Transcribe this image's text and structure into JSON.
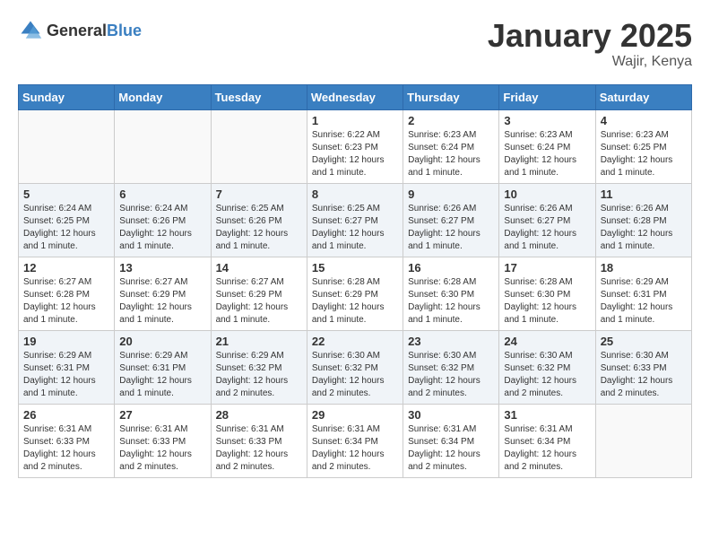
{
  "header": {
    "logo_general": "General",
    "logo_blue": "Blue",
    "month_title": "January 2025",
    "location": "Wajir, Kenya"
  },
  "weekdays": [
    "Sunday",
    "Monday",
    "Tuesday",
    "Wednesday",
    "Thursday",
    "Friday",
    "Saturday"
  ],
  "weeks": [
    [
      {
        "day": "",
        "info": ""
      },
      {
        "day": "",
        "info": ""
      },
      {
        "day": "",
        "info": ""
      },
      {
        "day": "1",
        "info": "Sunrise: 6:22 AM\nSunset: 6:23 PM\nDaylight: 12 hours\nand 1 minute."
      },
      {
        "day": "2",
        "info": "Sunrise: 6:23 AM\nSunset: 6:24 PM\nDaylight: 12 hours\nand 1 minute."
      },
      {
        "day": "3",
        "info": "Sunrise: 6:23 AM\nSunset: 6:24 PM\nDaylight: 12 hours\nand 1 minute."
      },
      {
        "day": "4",
        "info": "Sunrise: 6:23 AM\nSunset: 6:25 PM\nDaylight: 12 hours\nand 1 minute."
      }
    ],
    [
      {
        "day": "5",
        "info": "Sunrise: 6:24 AM\nSunset: 6:25 PM\nDaylight: 12 hours\nand 1 minute."
      },
      {
        "day": "6",
        "info": "Sunrise: 6:24 AM\nSunset: 6:26 PM\nDaylight: 12 hours\nand 1 minute."
      },
      {
        "day": "7",
        "info": "Sunrise: 6:25 AM\nSunset: 6:26 PM\nDaylight: 12 hours\nand 1 minute."
      },
      {
        "day": "8",
        "info": "Sunrise: 6:25 AM\nSunset: 6:27 PM\nDaylight: 12 hours\nand 1 minute."
      },
      {
        "day": "9",
        "info": "Sunrise: 6:26 AM\nSunset: 6:27 PM\nDaylight: 12 hours\nand 1 minute."
      },
      {
        "day": "10",
        "info": "Sunrise: 6:26 AM\nSunset: 6:27 PM\nDaylight: 12 hours\nand 1 minute."
      },
      {
        "day": "11",
        "info": "Sunrise: 6:26 AM\nSunset: 6:28 PM\nDaylight: 12 hours\nand 1 minute."
      }
    ],
    [
      {
        "day": "12",
        "info": "Sunrise: 6:27 AM\nSunset: 6:28 PM\nDaylight: 12 hours\nand 1 minute."
      },
      {
        "day": "13",
        "info": "Sunrise: 6:27 AM\nSunset: 6:29 PM\nDaylight: 12 hours\nand 1 minute."
      },
      {
        "day": "14",
        "info": "Sunrise: 6:27 AM\nSunset: 6:29 PM\nDaylight: 12 hours\nand 1 minute."
      },
      {
        "day": "15",
        "info": "Sunrise: 6:28 AM\nSunset: 6:29 PM\nDaylight: 12 hours\nand 1 minute."
      },
      {
        "day": "16",
        "info": "Sunrise: 6:28 AM\nSunset: 6:30 PM\nDaylight: 12 hours\nand 1 minute."
      },
      {
        "day": "17",
        "info": "Sunrise: 6:28 AM\nSunset: 6:30 PM\nDaylight: 12 hours\nand 1 minute."
      },
      {
        "day": "18",
        "info": "Sunrise: 6:29 AM\nSunset: 6:31 PM\nDaylight: 12 hours\nand 1 minute."
      }
    ],
    [
      {
        "day": "19",
        "info": "Sunrise: 6:29 AM\nSunset: 6:31 PM\nDaylight: 12 hours\nand 1 minute."
      },
      {
        "day": "20",
        "info": "Sunrise: 6:29 AM\nSunset: 6:31 PM\nDaylight: 12 hours\nand 1 minute."
      },
      {
        "day": "21",
        "info": "Sunrise: 6:29 AM\nSunset: 6:32 PM\nDaylight: 12 hours\nand 2 minutes."
      },
      {
        "day": "22",
        "info": "Sunrise: 6:30 AM\nSunset: 6:32 PM\nDaylight: 12 hours\nand 2 minutes."
      },
      {
        "day": "23",
        "info": "Sunrise: 6:30 AM\nSunset: 6:32 PM\nDaylight: 12 hours\nand 2 minutes."
      },
      {
        "day": "24",
        "info": "Sunrise: 6:30 AM\nSunset: 6:32 PM\nDaylight: 12 hours\nand 2 minutes."
      },
      {
        "day": "25",
        "info": "Sunrise: 6:30 AM\nSunset: 6:33 PM\nDaylight: 12 hours\nand 2 minutes."
      }
    ],
    [
      {
        "day": "26",
        "info": "Sunrise: 6:31 AM\nSunset: 6:33 PM\nDaylight: 12 hours\nand 2 minutes."
      },
      {
        "day": "27",
        "info": "Sunrise: 6:31 AM\nSunset: 6:33 PM\nDaylight: 12 hours\nand 2 minutes."
      },
      {
        "day": "28",
        "info": "Sunrise: 6:31 AM\nSunset: 6:33 PM\nDaylight: 12 hours\nand 2 minutes."
      },
      {
        "day": "29",
        "info": "Sunrise: 6:31 AM\nSunset: 6:34 PM\nDaylight: 12 hours\nand 2 minutes."
      },
      {
        "day": "30",
        "info": "Sunrise: 6:31 AM\nSunset: 6:34 PM\nDaylight: 12 hours\nand 2 minutes."
      },
      {
        "day": "31",
        "info": "Sunrise: 6:31 AM\nSunset: 6:34 PM\nDaylight: 12 hours\nand 2 minutes."
      },
      {
        "day": "",
        "info": ""
      }
    ]
  ]
}
